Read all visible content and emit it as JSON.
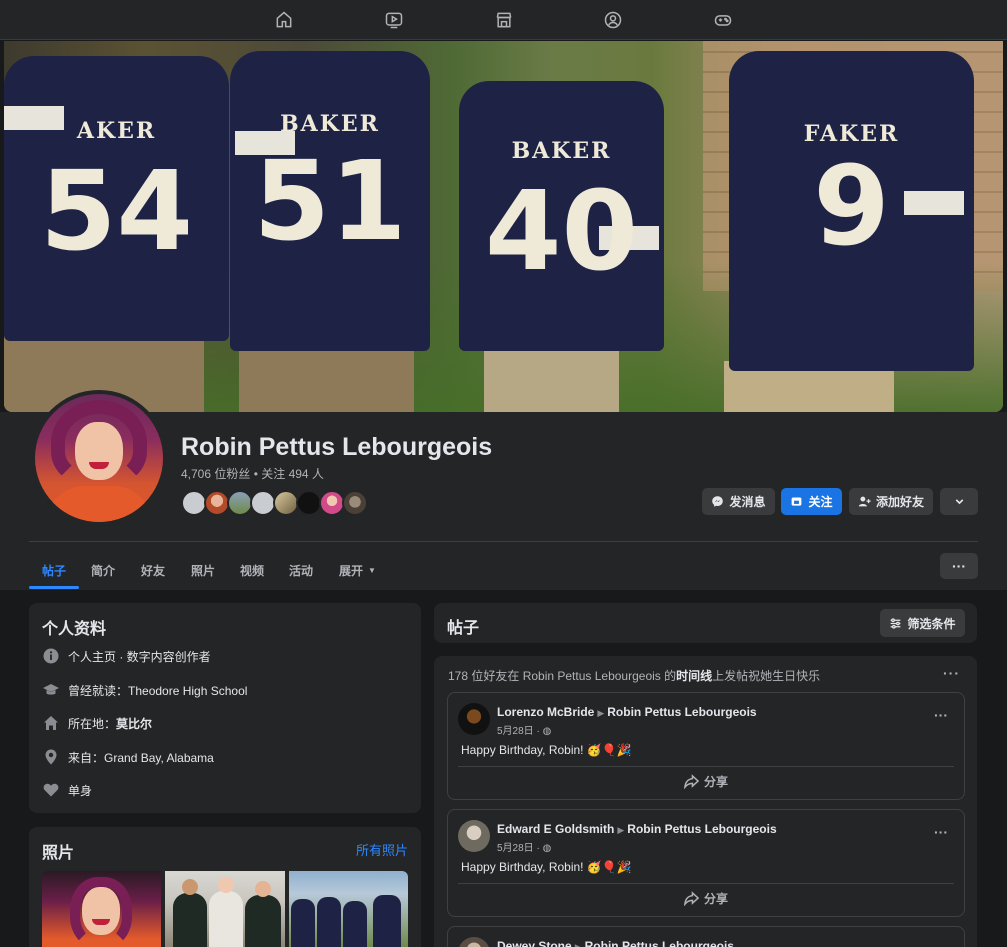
{
  "top_nav": {
    "icons": [
      "home-icon",
      "video-icon",
      "marketplace-icon",
      "groups-icon",
      "gaming-icon"
    ]
  },
  "cover": {
    "jersey_words": [
      "AKER",
      "BAKER",
      "BAKER",
      "FAKER"
    ],
    "jersey_numbers": [
      "54",
      "51",
      "40",
      "9"
    ]
  },
  "profile": {
    "name": "Robin Pettus Lebourgeois",
    "stats": "4,706 位粉丝 • 关注 494 人"
  },
  "actions": {
    "message": "发消息",
    "follow": "关注",
    "add_friend": "添加好友"
  },
  "tabs": [
    {
      "label": "帖子"
    },
    {
      "label": "简介"
    },
    {
      "label": "好友"
    },
    {
      "label": "照片"
    },
    {
      "label": "视频"
    },
    {
      "label": "活动"
    },
    {
      "label": "展开"
    }
  ],
  "intro": {
    "title": "个人资料",
    "rows": [
      {
        "icon": "info-icon",
        "text": "个人主页 · 数字内容创作者"
      },
      {
        "icon": "graduation-cap-icon",
        "prefix": "曾经就读：",
        "value": "Theodore High School"
      },
      {
        "icon": "home-icon",
        "prefix": "所在地：",
        "value": "莫比尔"
      },
      {
        "icon": "location-pin-icon",
        "prefix": "来自：",
        "value": "Grand Bay, Alabama"
      },
      {
        "icon": "heart-icon",
        "text": "单身"
      }
    ]
  },
  "photos": {
    "title": "照片",
    "link": "所有照片"
  },
  "posts": {
    "title": "帖子",
    "filter_label": "筛选条件",
    "summary_prefix": "178 位好友在 Robin Pettus Lebourgeois 的",
    "summary_bold": "时间线",
    "summary_suffix": "上发帖祝她生日快乐",
    "items": [
      {
        "author": "Lorenzo McBride",
        "target": "Robin Pettus Lebourgeois",
        "time": "5月28日 ·",
        "text": "Happy Birthday, Robin! 🥳🎈🎉",
        "share": "分享"
      },
      {
        "author": "Edward E Goldsmith",
        "target": "Robin Pettus Lebourgeois",
        "time": "5月28日 ·",
        "text": "Happy Birthday, Robin! 🥳🎈🎉",
        "share": "分享"
      },
      {
        "author": "Dewey Stone",
        "target": "Robin Pettus Lebourgeois"
      }
    ]
  },
  "colors": {
    "accent": "#2d88ff",
    "primary_button": "#1b74e4",
    "background": "#18191a",
    "surface": "#242526"
  }
}
